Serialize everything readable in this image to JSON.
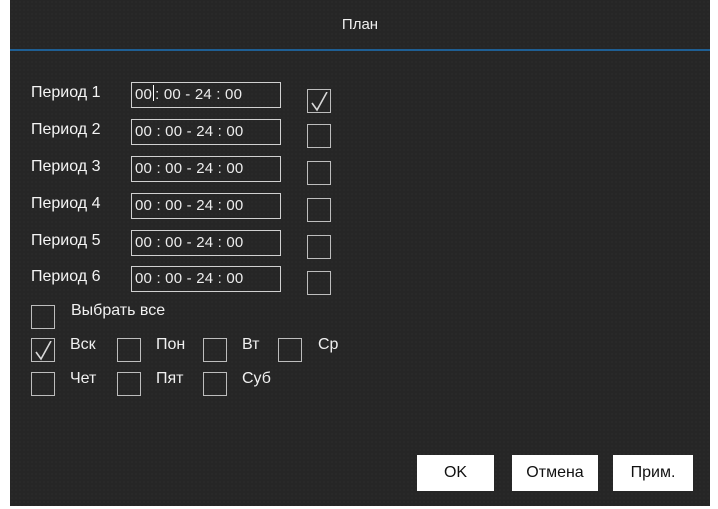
{
  "dialog": {
    "title": "План",
    "periods": [
      {
        "label": "Период 1",
        "time": "00",
        "time_rest": ": 00 - 24 : 00",
        "checked": true
      },
      {
        "label": "Период 2",
        "time": "00 : 00 - 24 : 00",
        "checked": false
      },
      {
        "label": "Период 3",
        "time": "00 : 00 - 24 : 00",
        "checked": false
      },
      {
        "label": "Период 4",
        "time": "00 : 00 - 24 : 00",
        "checked": false
      },
      {
        "label": "Период 5",
        "time": "00 : 00 - 24 : 00",
        "checked": false
      },
      {
        "label": "Период 6",
        "time": "00 : 00 - 24 : 00",
        "checked": false
      }
    ],
    "select_all": {
      "label": "Выбрать все",
      "checked": false
    },
    "days": [
      {
        "label": "Вск",
        "checked": true
      },
      {
        "label": "Пон",
        "checked": false
      },
      {
        "label": "Вт",
        "checked": false
      },
      {
        "label": "Ср",
        "checked": false
      },
      {
        "label": "Чет",
        "checked": false
      },
      {
        "label": "Пят",
        "checked": false
      },
      {
        "label": "Суб",
        "checked": false
      }
    ],
    "buttons": {
      "ok": "OK",
      "cancel": "Отмена",
      "apply": "Прим."
    }
  },
  "colors": {
    "background": "#262626",
    "accent_rule": "#1f5f94",
    "text": "#f0f0f0",
    "button_bg": "#ffffff"
  },
  "icons": {
    "check": "checkmark-icon"
  }
}
